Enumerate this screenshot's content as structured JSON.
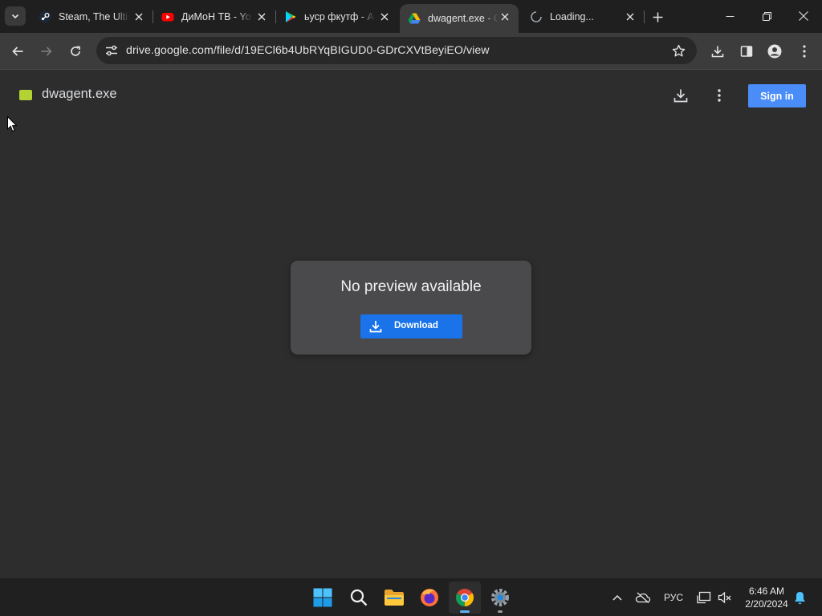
{
  "browser": {
    "tabs": [
      {
        "title": "Steam, The Ultimate Online Game Platform",
        "favicon": "steam-icon",
        "active": false
      },
      {
        "title": "ДиМоН ТВ - YouTube",
        "favicon": "youtube-icon",
        "active": false
      },
      {
        "title": "ьуср фкутф - Apps on Google Play",
        "favicon": "google-play-icon",
        "active": false
      },
      {
        "title": "dwagent.exe - Google Drive",
        "favicon": "google-drive-icon",
        "active": true
      },
      {
        "title": "Loading...",
        "favicon": "loading-spinner-icon",
        "active": false
      }
    ],
    "url": "drive.google.com/file/d/19ECl6b4UbRYqBIGUD0-GDrCXVtBeyiEO/view"
  },
  "drive": {
    "file_name": "dwagent.exe",
    "sign_in_label": "Sign in",
    "no_preview_text": "No preview available",
    "download_label": "Download"
  },
  "taskbar": {
    "language": "РУС",
    "time": "6:46 AM",
    "date": "2/20/2024"
  },
  "colors": {
    "accent_blue": "#1a73e8",
    "sign_in_blue": "#4b8df8",
    "file_icon_green": "#b3d234"
  }
}
